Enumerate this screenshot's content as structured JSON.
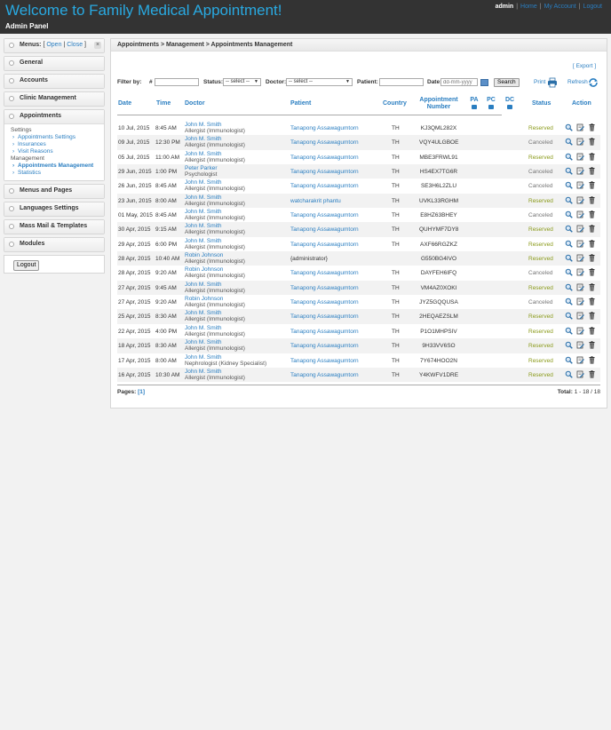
{
  "header": {
    "site_title": "Welcome to Family Medical Appointment!",
    "panel_title": "Admin Panel",
    "user": "admin",
    "links": [
      "Home",
      "My Account",
      "Logout"
    ]
  },
  "sidebar": {
    "menus_label": "Menus:",
    "open_label": "Open",
    "close_label": "Close",
    "sections": [
      "General",
      "Accounts",
      "Clinic Management",
      "Appointments",
      "Menus and Pages",
      "Languages Settings",
      "Mass Mail & Templates",
      "Modules"
    ],
    "appointments": {
      "settings_label": "Settings",
      "settings_items": [
        "Appointments Settings",
        "Insurances",
        "Visit Reasons"
      ],
      "management_label": "Management",
      "management_items": [
        "Appointments Management",
        "Statistics"
      ]
    },
    "logout_label": "Logout"
  },
  "main": {
    "breadcrumb": "Appointments > Management > Appointments Management",
    "export_label": "[ Export ]",
    "print_label": "Print",
    "refresh_label": "Refresh"
  },
  "filter": {
    "label": "Filter by:",
    "number_label": "#",
    "status_label": "Status:",
    "status_value": "-- select --",
    "doctor_label": "Doctor:",
    "doctor_value": "-- select --",
    "patient_label": "Patient:",
    "date_label": "Date:",
    "date_placeholder": "dd-mm-yyyy",
    "search_label": "Search"
  },
  "table": {
    "columns": {
      "date": "Date",
      "time": "Time",
      "doctor": "Doctor",
      "patient": "Patient",
      "country": "Country",
      "number1": "Appointment",
      "number2": "Number",
      "pa": "PA",
      "pc": "PC",
      "dc": "DC",
      "status": "Status",
      "action": "Action"
    },
    "rows": [
      {
        "date": "10 Jul, 2015",
        "time": "8:45 AM",
        "doctor": "John M. Smith",
        "specialty": "Allergist (Immunologist)",
        "patient": "Tanapong Assawagumtorn",
        "country": "TH",
        "number": "KJ3QML282X",
        "status": "Reserved"
      },
      {
        "date": "09 Jul, 2015",
        "time": "12:30 PM",
        "doctor": "John M. Smith",
        "specialty": "Allergist (Immunologist)",
        "patient": "Tanapong Assawagumtorn",
        "country": "TH",
        "number": "VQY4ULGBOE",
        "status": "Canceled"
      },
      {
        "date": "05 Jul, 2015",
        "time": "11:00 AM",
        "doctor": "John M. Smith",
        "specialty": "Allergist (Immunologist)",
        "patient": "Tanapong Assawagumtorn",
        "country": "TH",
        "number": "MBE3FRWL91",
        "status": "Reserved"
      },
      {
        "date": "29 Jun, 2015",
        "time": "1:00 PM",
        "doctor": "Peter Parker",
        "specialty": "Psychologist",
        "patient": "Tanapong Assawagumtorn",
        "country": "TH",
        "number": "HS4EX7TG6R",
        "status": "Canceled"
      },
      {
        "date": "26 Jun, 2015",
        "time": "8:45 AM",
        "doctor": "John M. Smith",
        "specialty": "Allergist (Immunologist)",
        "patient": "Tanapong Assawagumtorn",
        "country": "TH",
        "number": "SE3H6L2ZLU",
        "status": "Canceled"
      },
      {
        "date": "23 Jun, 2015",
        "time": "8:00 AM",
        "doctor": "John M. Smith",
        "specialty": "Allergist (Immunologist)",
        "patient": "watcharakrit phantu",
        "country": "TH",
        "number": "UVKL33RGHM",
        "status": "Reserved"
      },
      {
        "date": "01 May, 2015",
        "time": "8:45 AM",
        "doctor": "John M. Smith",
        "specialty": "Allergist (Immunologist)",
        "patient": "Tanapong Assawagumtorn",
        "country": "TH",
        "number": "E8HZ63BHEY",
        "status": "Canceled"
      },
      {
        "date": "30 Apr, 2015",
        "time": "9:15 AM",
        "doctor": "John M. Smith",
        "specialty": "Allergist (Immunologist)",
        "patient": "Tanapong Assawagumtorn",
        "country": "TH",
        "number": "QUHYMF7DY8",
        "status": "Reserved"
      },
      {
        "date": "29 Apr, 2015",
        "time": "6:00 PM",
        "doctor": "John M. Smith",
        "specialty": "Allergist (Immunologist)",
        "patient": "Tanapong Assawagumtorn",
        "country": "TH",
        "number": "AXF66RGZKZ",
        "status": "Reserved"
      },
      {
        "date": "28 Apr, 2015",
        "time": "10:40 AM",
        "doctor": "Robin Johnson",
        "specialty": "Allergist (Immunologist)",
        "patient": "{administrator}",
        "country": "",
        "number": "G550BG4IVO",
        "status": "Reserved"
      },
      {
        "date": "28 Apr, 2015",
        "time": "9:20 AM",
        "doctor": "Robin Johnson",
        "specialty": "Allergist (Immunologist)",
        "patient": "Tanapong Assawagumtorn",
        "country": "TH",
        "number": "DAYFEH6IFQ",
        "status": "Canceled"
      },
      {
        "date": "27 Apr, 2015",
        "time": "9:45 AM",
        "doctor": "John M. Smith",
        "specialty": "Allergist (Immunologist)",
        "patient": "Tanapong Assawagumtorn",
        "country": "TH",
        "number": "VM4AZ0XOKI",
        "status": "Reserved"
      },
      {
        "date": "27 Apr, 2015",
        "time": "9:20 AM",
        "doctor": "Robin Johnson",
        "specialty": "Allergist (Immunologist)",
        "patient": "Tanapong Assawagumtorn",
        "country": "TH",
        "number": "JYZ5GQQUSA",
        "status": "Canceled"
      },
      {
        "date": "25 Apr, 2015",
        "time": "8:30 AM",
        "doctor": "John M. Smith",
        "specialty": "Allergist (Immunologist)",
        "patient": "Tanapong Assawagumtorn",
        "country": "TH",
        "number": "2HEQAEZSLM",
        "status": "Reserved"
      },
      {
        "date": "22 Apr, 2015",
        "time": "4:00 PM",
        "doctor": "John M. Smith",
        "specialty": "Allergist (Immunologist)",
        "patient": "Tanapong Assawagumtorn",
        "country": "TH",
        "number": "P1O1MHPSIV",
        "status": "Reserved"
      },
      {
        "date": "18 Apr, 2015",
        "time": "8:30 AM",
        "doctor": "John M. Smith",
        "specialty": "Allergist (Immunologist)",
        "patient": "Tanapong Assawagumtorn",
        "country": "TH",
        "number": "9H33VV6SO",
        "status": "Reserved"
      },
      {
        "date": "17 Apr, 2015",
        "time": "8:00 AM",
        "doctor": "John M. Smith",
        "specialty": "Nephrologist (Kidney Specialist)",
        "patient": "Tanapong Assawagumtorn",
        "country": "TH",
        "number": "7Y674HOO2N",
        "status": "Reserved"
      },
      {
        "date": "16 Apr, 2015",
        "time": "10:30 AM",
        "doctor": "John M. Smith",
        "specialty": "Allergist (Immunologist)",
        "patient": "Tanapong Assawagumtorn",
        "country": "TH",
        "number": "Y4KWFV1DRE",
        "status": "Reserved"
      }
    ],
    "pages_label": "Pages:",
    "pages_value": "[1]",
    "total_label": "Total:",
    "total_value": "1 - 18 / 18"
  },
  "colors": {
    "header_bg": "#333333",
    "title": "#29a9e1",
    "link": "#2a7ec1",
    "reserved": "#8a9a1a",
    "canceled": "#777777"
  },
  "icons": [
    "print-icon",
    "refresh-icon",
    "calendar-icon",
    "view-icon",
    "edit-icon",
    "delete-icon"
  ]
}
